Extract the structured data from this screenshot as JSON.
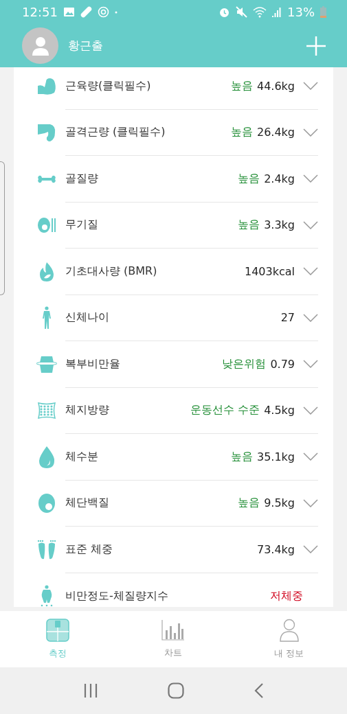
{
  "status_bar": {
    "time": "12:51",
    "battery": "13%"
  },
  "header": {
    "user_name": "황근출"
  },
  "rows": [
    {
      "kind": "muscle",
      "label": "근육량(클릭필수)",
      "status": {
        "text": "높음",
        "color": "#1e8c32"
      },
      "value": "44.6kg",
      "expandable": true
    },
    {
      "kind": "skeletal",
      "label": "골격근량 (클릭필수)",
      "status": {
        "text": "높음",
        "color": "#1e8c32"
      },
      "value": "26.4kg",
      "expandable": true
    },
    {
      "kind": "bone",
      "label": "골질량",
      "status": {
        "text": "높음",
        "color": "#1e8c32"
      },
      "value": "2.4kg",
      "expandable": true
    },
    {
      "kind": "mineral",
      "label": "무기질",
      "status": {
        "text": "높음",
        "color": "#1e8c32"
      },
      "value": "3.3kg",
      "expandable": true
    },
    {
      "kind": "flame",
      "label": "기초대사량 (BMR)",
      "value": "1403kcal",
      "expandable": true
    },
    {
      "kind": "body",
      "label": "신체나이",
      "value": "27",
      "expandable": true
    },
    {
      "kind": "waist",
      "label": "복부비만율",
      "status": {
        "text": "낮은위험",
        "color": "#1e8c32"
      },
      "value": "0.79",
      "expandable": true
    },
    {
      "kind": "fat",
      "label": "체지방량",
      "status": {
        "text": "운동선수 수준",
        "color": "#1e8c32"
      },
      "value": "4.5kg",
      "expandable": true
    },
    {
      "kind": "drop",
      "label": "체수분",
      "status": {
        "text": "높음",
        "color": "#1e8c32"
      },
      "value": "35.1kg",
      "expandable": true
    },
    {
      "kind": "protein",
      "label": "체단백질",
      "status": {
        "text": "높음",
        "color": "#1e8c32"
      },
      "value": "9.5kg",
      "expandable": true
    },
    {
      "kind": "feet",
      "label": "표준 체중",
      "value": "73.4kg",
      "expandable": true
    },
    {
      "kind": "obese",
      "label": "비만정도-체질량지수",
      "status": {
        "text": "저체중",
        "color": "#d0021b"
      },
      "expandable": false
    }
  ],
  "tabs": [
    {
      "kind": "scale",
      "label": "측정",
      "selected": true
    },
    {
      "kind": "chart",
      "label": "차트",
      "selected": false
    },
    {
      "kind": "person",
      "label": "내 정보",
      "selected": false
    }
  ]
}
